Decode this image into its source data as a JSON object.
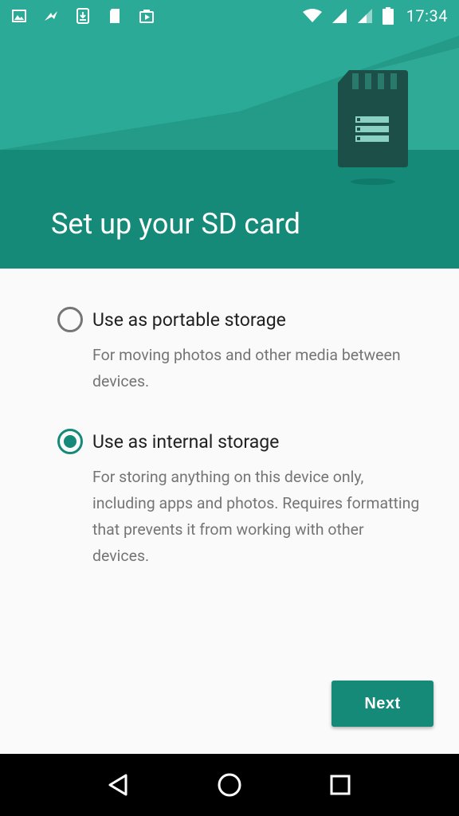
{
  "statusbar": {
    "left_icons": [
      "gallery-icon",
      "signal-app-icon",
      "download-icon",
      "sd-card-icon",
      "play-store-icon"
    ],
    "right_icons": [
      "wifi-icon",
      "cell-signal-icon",
      "cell-signal-2-icon",
      "battery-icon"
    ],
    "time": "17:34"
  },
  "header": {
    "title": "Set up your SD card",
    "illustration": "sd-card-illustration"
  },
  "options": [
    {
      "label": "Use as portable storage",
      "description": "For moving photos and other media between devices.",
      "selected": false
    },
    {
      "label": "Use as internal storage",
      "description": "For storing anything on this device only, including apps and photos. Requires formatting that prevents it from working with other devices.",
      "selected": true
    }
  ],
  "actions": {
    "next_label": "Next"
  },
  "navbar": {
    "buttons": [
      "back-icon",
      "home-icon",
      "recents-icon"
    ]
  },
  "colors": {
    "accent": "#158a78",
    "header_light": "#2aa896"
  }
}
